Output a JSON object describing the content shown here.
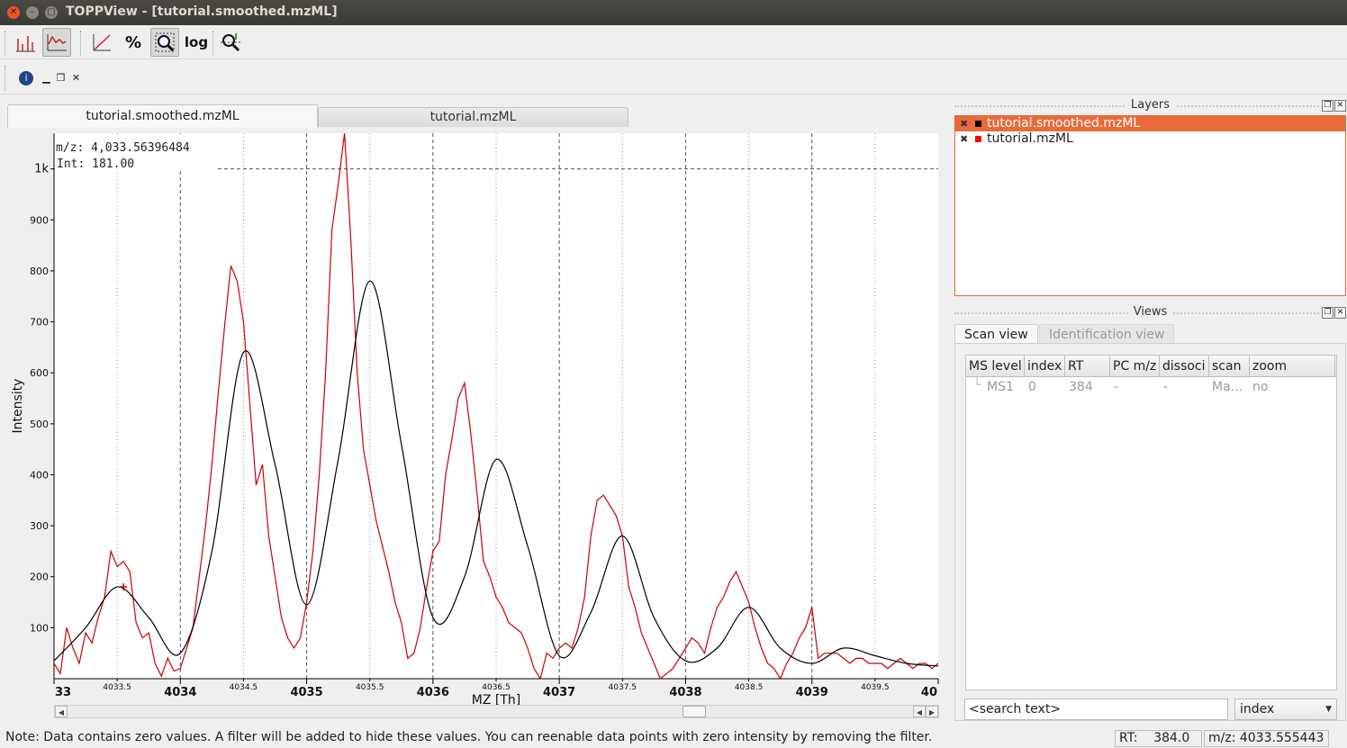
{
  "window": {
    "title": "TOPPView - [tutorial.smoothed.mzML]"
  },
  "toolbar": {
    "buttons": [
      {
        "name": "draw-peaks",
        "icon": "peaks-icon",
        "active": false
      },
      {
        "name": "draw-raw",
        "icon": "raw-line-icon",
        "active": true
      },
      {
        "name": "linear-intensity",
        "icon": "linear-axis-icon",
        "active": false
      },
      {
        "name": "percentage-intensity",
        "label": "%",
        "active": false
      },
      {
        "name": "snap-intensity",
        "icon": "zoom-snap-icon",
        "active": true
      },
      {
        "name": "log-intensity",
        "label": "log",
        "active": false
      },
      {
        "name": "compare-spectra",
        "icon": "mirror-compare-icon",
        "active": false
      }
    ]
  },
  "tabs": [
    {
      "label": "tutorial.smoothed.mzML",
      "selected": true
    },
    {
      "label": "tutorial.mzML",
      "selected": false
    }
  ],
  "plot": {
    "cursor_mz_label": "m/z: 4,033.56396484",
    "cursor_int_label": "Int: 181.00"
  },
  "chart_data": {
    "type": "line",
    "xlabel": "MZ [Th]",
    "ylabel": "Intensity",
    "xlim": [
      4033,
      4040
    ],
    "ylim": [
      0,
      1070
    ],
    "x_ticks_major": [
      "33",
      "4034",
      "4035",
      "4036",
      "4037",
      "4038",
      "4039",
      "40"
    ],
    "x_ticks_minor": [
      "4033.5",
      "4034.5",
      "4035.5",
      "4036.5",
      "4037.5",
      "4038.5",
      "4039.5"
    ],
    "y_ticks": [
      "100",
      "200",
      "300",
      "400",
      "500",
      "600",
      "700",
      "800",
      "900",
      "1k"
    ],
    "series": [
      {
        "color": "#cc0000",
        "x": [
          4033,
          4033.05,
          4033.1,
          4033.15,
          4033.2,
          4033.25,
          4033.3,
          4033.35,
          4033.4,
          4033.45,
          4033.5,
          4033.55,
          4033.6,
          4033.65,
          4033.7,
          4033.75,
          4033.8,
          4033.85,
          4033.9,
          4033.95,
          4034,
          4034.05,
          4034.1,
          4034.15,
          4034.2,
          4034.25,
          4034.3,
          4034.35,
          4034.4,
          4034.45,
          4034.5,
          4034.55,
          4034.6,
          4034.65,
          4034.7,
          4034.75,
          4034.8,
          4034.85,
          4034.9,
          4034.95,
          4035,
          4035.05,
          4035.1,
          4035.15,
          4035.2,
          4035.25,
          4035.3,
          4035.35,
          4035.4,
          4035.45,
          4035.5,
          4035.55,
          4035.6,
          4035.65,
          4035.7,
          4035.75,
          4035.8,
          4035.85,
          4035.9,
          4035.95,
          4036,
          4036.05,
          4036.1,
          4036.15,
          4036.2,
          4036.25,
          4036.3,
          4036.35,
          4036.4,
          4036.45,
          4036.5,
          4036.55,
          4036.6,
          4036.65,
          4036.7,
          4036.75,
          4036.8,
          4036.85,
          4036.9,
          4036.95,
          4037,
          4037.05,
          4037.1,
          4037.15,
          4037.2,
          4037.25,
          4037.3,
          4037.35,
          4037.4,
          4037.45,
          4037.5,
          4037.55,
          4037.6,
          4037.65,
          4037.7,
          4037.75,
          4037.8,
          4037.85,
          4037.9,
          4037.95,
          4038,
          4038.05,
          4038.1,
          4038.15,
          4038.2,
          4038.25,
          4038.3,
          4038.35,
          4038.4,
          4038.45,
          4038.5,
          4038.55,
          4038.6,
          4038.65,
          4038.7,
          4038.75,
          4038.8,
          4038.85,
          4038.9,
          4038.95,
          4039,
          4039.05,
          4039.1,
          4039.15,
          4039.2,
          4039.25,
          4039.3,
          4039.35,
          4039.4,
          4039.45,
          4039.5,
          4039.55,
          4039.6,
          4039.65,
          4039.7,
          4039.75,
          4039.8,
          4039.85,
          4039.9,
          4039.95,
          4040
        ],
        "y": [
          30,
          10,
          100,
          60,
          30,
          90,
          70,
          120,
          160,
          250,
          220,
          230,
          210,
          110,
          80,
          90,
          30,
          5,
          40,
          15,
          20,
          60,
          100,
          200,
          300,
          420,
          560,
          690,
          810,
          780,
          700,
          540,
          380,
          420,
          280,
          200,
          120,
          80,
          60,
          80,
          150,
          250,
          400,
          600,
          880,
          970,
          1070,
          860,
          600,
          450,
          380,
          310,
          260,
          210,
          150,
          110,
          40,
          50,
          100,
          180,
          250,
          270,
          400,
          470,
          550,
          580,
          480,
          360,
          230,
          200,
          160,
          140,
          110,
          100,
          90,
          60,
          20,
          0,
          50,
          40,
          60,
          70,
          60,
          100,
          160,
          280,
          350,
          360,
          340,
          320,
          280,
          180,
          140,
          90,
          60,
          30,
          0,
          10,
          20,
          40,
          60,
          80,
          70,
          50,
          100,
          140,
          160,
          190,
          210,
          180,
          150,
          100,
          60,
          30,
          20,
          0,
          30,
          50,
          80,
          100,
          140,
          40,
          50,
          50,
          50,
          40,
          30,
          40,
          40,
          30,
          30,
          30,
          20,
          30,
          40,
          30,
          20,
          30,
          30,
          20,
          30
        ]
      },
      {
        "color": "#000000",
        "x": [
          4033,
          4033.25,
          4033.5,
          4033.75,
          4034,
          4034.25,
          4034.5,
          4034.75,
          4035,
          4035.25,
          4035.5,
          4035.75,
          4036,
          4036.25,
          4036.5,
          4036.75,
          4037,
          4037.25,
          4037.5,
          4037.75,
          4038,
          4038.25,
          4038.5,
          4038.75,
          4039,
          4039.25,
          4039.5,
          4039.75,
          4040
        ],
        "y": [
          35,
          100,
          180,
          120,
          50,
          250,
          640,
          420,
          145,
          430,
          780,
          460,
          120,
          200,
          430,
          260,
          45,
          130,
          280,
          120,
          35,
          60,
          140,
          60,
          30,
          60,
          45,
          30,
          25
        ]
      }
    ]
  },
  "scrollbar": {
    "position": 0.72
  },
  "layers_panel": {
    "title": "Layers",
    "items": [
      {
        "label": "tutorial.smoothed.mzML",
        "selected": true,
        "color": "#000000"
      },
      {
        "label": "tutorial.mzML",
        "selected": false,
        "color": "#ff0000"
      }
    ]
  },
  "views_panel": {
    "title": "Views",
    "tabs": [
      {
        "label": "Scan view",
        "selected": true
      },
      {
        "label": "Identification view",
        "selected": false
      }
    ],
    "columns": [
      "MS level",
      "index",
      "RT",
      "PC m/z",
      "dissoci",
      "scan",
      "zoom"
    ],
    "rows": [
      [
        "MS1",
        "0",
        "384",
        "-",
        "-",
        "Ma…",
        "no"
      ]
    ],
    "search_placeholder": "<search text>",
    "search_field": "index"
  },
  "statusbar": {
    "note": "Note: Data contains zero values. A filter will be added to hide these values. You can reenable data points with zero intensity by removing the filter.",
    "rt": "RT:    384.0",
    "mz": "m/z: 4033.555443"
  }
}
